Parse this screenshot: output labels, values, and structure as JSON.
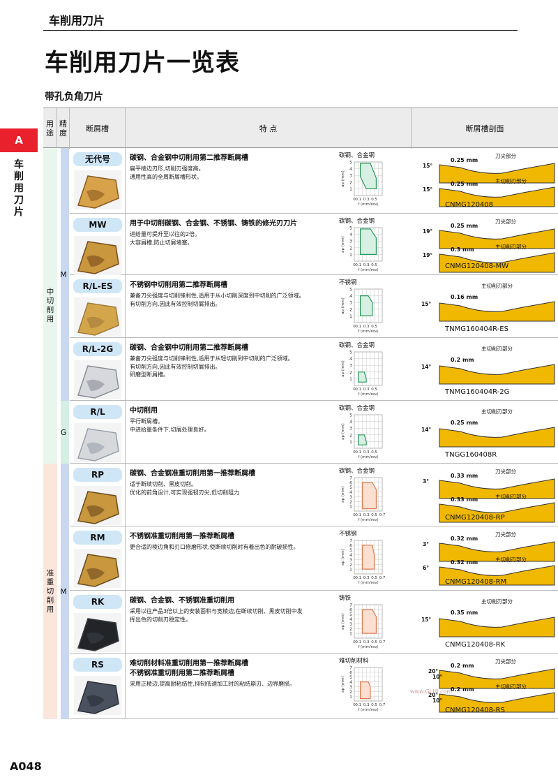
{
  "header": {
    "category": "车削用刀片"
  },
  "title": "车削用刀片一览表",
  "section": "带孔负角刀片",
  "side": {
    "tab": "A",
    "vertical": "车削用刀片"
  },
  "table_headers": {
    "use": "用途",
    "precision": "精度",
    "chipbreaker": "断屑槽",
    "features": "特  点",
    "profile": "断屑槽剖面"
  },
  "groups": {
    "medium": "中切削用",
    "semi_heavy": "准重切削用"
  },
  "graph_axes": {
    "y": "ap (mm)",
    "x": "f (mm/rev)"
  },
  "rows": [
    {
      "name": "无代号",
      "title": "碳钢、合金钢中切削用第二推荐断屑槽",
      "desc": [
        "扁平棱边刃形,切削刃强度高。",
        "通用性高的全周断屑槽形状。"
      ],
      "material": "碳钢、合金钢",
      "code": "CNMG120408",
      "ang1": "15°",
      "w1": "0.25 mm",
      "lab1": "刀尖部分",
      "ang2": "15°",
      "w2": "0.25 mm",
      "lab2": "主切削刃部分"
    },
    {
      "name": "MW",
      "title": "用于中切削碳钢、合金钢、不锈钢、铸铁的修光刃刀片",
      "desc": [
        "进给量可提升至以往的2倍。",
        "大容屑槽,防止切屑堵塞。"
      ],
      "material": "碳钢、合金钢",
      "code": "CNMG120408-MW",
      "ang1": "19°",
      "w1": "0.25 mm",
      "lab1": "刀尖部分",
      "ang2": "19°",
      "w2": "0.3 mm",
      "lab2": "主切削刃部分"
    },
    {
      "name": "R/L-ES",
      "title": "不锈钢中切削用第二推荐断屑槽",
      "desc": [
        "兼备刀尖强度与切削锋利性,适用于从小切削深度到中切削的广泛领域。",
        "有切削方向,因此有效控制切屑排出。"
      ],
      "material": "不锈钢",
      "code": "TNMG160404R-ES",
      "ang1": "15°",
      "w1": "0.16 mm",
      "lab1": "主切削刃部分"
    },
    {
      "name": "R/L-2G",
      "title": "碳钢、合金钢中切削用第二推荐断屑槽",
      "desc": [
        "兼备刀尖强度与切削锋利性,适用于从轻切削到中切削的广泛领域。",
        "有切削方向,因此有效控制切屑排出。",
        "研磨型断屑槽。"
      ],
      "material": "碳钢、合金钢",
      "code": "TNMG160404R-2G",
      "ang1": "14°",
      "w1": "0.2 mm",
      "lab1": "主切削刃部分"
    },
    {
      "name": "R/L",
      "title": "中切削用",
      "desc": [
        "平行断屑槽。",
        "中进给量条件下,切屑处理良好。"
      ],
      "material": "碳钢、合金钢",
      "code": "TNGG160408R",
      "ang1": "14°",
      "w1": "0.25 mm",
      "lab1": "主切削刃部分"
    },
    {
      "name": "RP",
      "title": "碳钢、合金钢准重切削用第一推荐断屑槽",
      "desc": [
        "适于断续切削、黑皮切削。",
        "优化的前角设计,可实现强韧刃尖,低切削阻力"
      ],
      "material": "碳钢、合金钢",
      "code": "CNMG120408-RP",
      "ang1": "3°",
      "w1": "0.33 mm",
      "lab1": "刀尖部分",
      "w2": "0.33 mm",
      "lab2": "主切削刃部分"
    },
    {
      "name": "RM",
      "title": "不锈钢准重切削用第一推荐断屑槽",
      "desc": [
        "更合适的棱边角和刃口修磨形状,使断续切削时有着出色的耐破损性。"
      ],
      "material": "不锈钢",
      "code": "CNMG120408-RM",
      "ang1": "3°",
      "w1": "0.32 mm",
      "lab1": "刀尖部分",
      "ang2": "6°",
      "w2": "0.32 mm",
      "lab2": "主切削刃部分"
    },
    {
      "name": "RK",
      "title": "碳钢、合金钢、不锈钢准重切削用",
      "desc": [
        "采用以往产品3倍以上的安装面积与宽棱边,在断续切削、黑皮切削中发",
        "挥出色的切削刃稳定性。"
      ],
      "material": "铸铁",
      "code": "CNMG120408-RK",
      "ang1": "15°",
      "w1": "0.35 mm",
      "lab1": "主切削刃部分"
    },
    {
      "name": "RS",
      "title": "难切削材料准重切削用第一推荐断屑槽",
      "title2": "不锈钢准重切削用第二推荐断屑槽",
      "desc": [
        "采用正棱边,提高耐粘结性,抑制低速加工时的粘结崩刃、边界磨损。"
      ],
      "material": "难切削材料",
      "code": "CNMG120408-RS",
      "ang1": "20°",
      "ang1b": "10°",
      "w1": "0.2 mm",
      "lab1": "刀尖部分",
      "ang2": "20°",
      "ang2b": "10°",
      "w2": "0.2 mm",
      "lab2": "主切削刃部分"
    }
  ],
  "precision": {
    "M1": "M",
    "G": "G",
    "M2": "M"
  },
  "page_number": "A048",
  "colors": {
    "accent_red": "#e8212d",
    "badge_blue": "#cfe6f7",
    "graph_green": "#d7f0e3",
    "graph_orange": "#fbe0d2",
    "profile_gold": "#f0b800"
  }
}
